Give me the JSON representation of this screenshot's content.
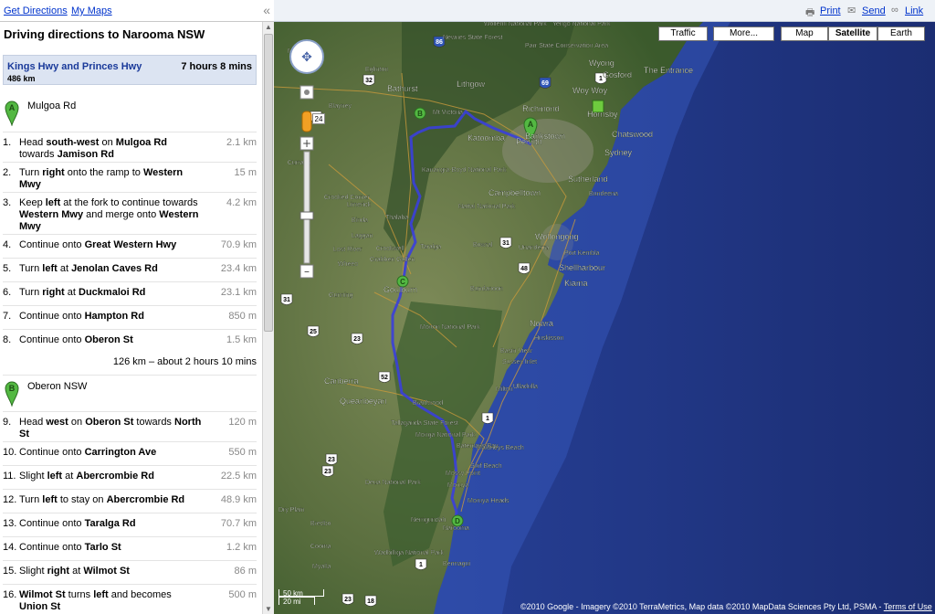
{
  "header": {
    "get_directions": "Get Directions",
    "my_maps": "My Maps",
    "collapse": "«"
  },
  "directions": {
    "title": "Driving directions to Narooma NSW",
    "route": {
      "name": "Kings Hwy and Princes Hwy",
      "time": "7 hours 8 mins",
      "distance": "486 km"
    },
    "waypoint_a": {
      "label": "A",
      "name": "Mulgoa Rd"
    },
    "waypoint_b": {
      "label": "B",
      "name": "Oberon NSW"
    },
    "summary_ab": "126 km – about 2 hours 10 mins",
    "steps": [
      {
        "n": "1.",
        "t": "Head <b>south-west</b> on <b>Mulgoa Rd</b> towards <b>Jamison Rd</b>",
        "d": "2.1 km"
      },
      {
        "n": "2.",
        "t": "Turn <b>right</b> onto the ramp to <b>Western Mwy</b>",
        "d": "15 m"
      },
      {
        "n": "3.",
        "t": "Keep <b>left</b> at the fork to continue towards <b>Western Mwy</b> and merge onto <b>Western Mwy</b>",
        "d": "4.2 km"
      },
      {
        "n": "4.",
        "t": "Continue onto <b>Great Western Hwy</b>",
        "d": "70.9 km"
      },
      {
        "n": "5.",
        "t": "Turn <b>left</b> at <b>Jenolan Caves Rd</b>",
        "d": "23.4 km"
      },
      {
        "n": "6.",
        "t": "Turn <b>right</b> at <b>Duckmaloi Rd</b>",
        "d": "23.1 km"
      },
      {
        "n": "7.",
        "t": "Continue onto <b>Hampton Rd</b>",
        "d": "850 m"
      },
      {
        "n": "8.",
        "t": "Continue onto <b>Oberon St</b>",
        "d": "1.5 km"
      }
    ],
    "steps_b": [
      {
        "n": "9.",
        "t": "Head <b>west</b> on <b>Oberon St</b> towards <b>North St</b>",
        "d": "120 m"
      },
      {
        "n": "10.",
        "t": "Continue onto <b>Carrington Ave</b>",
        "d": "550 m"
      },
      {
        "n": "11.",
        "t": "Slight <b>left</b> at <b>Abercrombie Rd</b>",
        "d": "22.5 km"
      },
      {
        "n": "12.",
        "t": "Turn <b>left</b> to stay on <b>Abercrombie Rd</b>",
        "d": "48.9 km"
      },
      {
        "n": "13.",
        "t": "Continue onto <b>Taralga Rd</b>",
        "d": "70.7 km"
      },
      {
        "n": "14.",
        "t": "Continue onto <b>Tarlo St</b>",
        "d": "1.2 km"
      },
      {
        "n": "15.",
        "t": "Slight <b>right</b> at <b>Wilmot St</b>",
        "d": "86 m"
      },
      {
        "n": "16.",
        "t": "<b>Wilmot St</b> turns <b>left</b> and becomes <b>Union St</b>",
        "d": "500 m"
      }
    ]
  },
  "map_toolbar": {
    "print": "Print",
    "send": "Send",
    "link": "Link",
    "buttons": [
      "Traffic",
      "More...",
      "Map",
      "Satellite",
      "Earth"
    ],
    "selected": "Satellite"
  },
  "map": {
    "places": [
      "Wollemi National Park",
      "Yengo National Park",
      "Mudgee",
      "Newnes State Forest",
      "Parr State Conservation Area",
      "Wyong",
      "The Entrance",
      "Gosford",
      "Eglinton",
      "Bathurst",
      "Lithgow",
      "Mt Victoria",
      "Richmond",
      "Woy Woy",
      "Hornsby",
      "Blayney",
      "Katoomba",
      "Penrith",
      "Chatswood",
      "Sydney",
      "Bankstown",
      "Sutherland",
      "Kanangra-Boyd National Park",
      "Campbelltown",
      "Curragh",
      "Crooked Corner",
      "Limerick",
      "Thalaba",
      "Binda",
      "Laggan",
      "Nattai National Park",
      "Wollongong",
      "Bundeena",
      "Taralga",
      "Bowral",
      "Unanderra",
      "Port Kembla",
      "Lost River",
      "Crookwell",
      "Wheeo",
      "Grabben Gullen",
      "Shellharbour",
      "Kiama",
      "Gunning",
      "Goulburn",
      "Bundanoon",
      "Morton National Park",
      "Nowra",
      "Huskisson",
      "Canberra",
      "Queanbeyan",
      "Braidwood",
      "Basin View",
      "Sussex Inlet",
      "Ulladulla",
      "Milton",
      "Tallaganda State Forest",
      "Monga National Park",
      "Batemans Bay",
      "Maloneys Beach",
      "Surf Beach",
      "Mossy Point",
      "Moruya",
      "Moruya Heads",
      "Deua National Park",
      "Nerrigundah",
      "Narooma",
      "Bermagui",
      "Wadbilliga National Park",
      "Dry Plain",
      "Bredbo",
      "Cooma",
      "Myalla"
    ],
    "scale_km": "50 km",
    "scale_mi": "20 mi",
    "copyright": "©2010 Google - Imagery ©2010 TerraMetrics, Map data ©2010 MapData Sciences Pty Ltd, PSMA -",
    "terms": "Terms of Use",
    "markers": [
      "A",
      "B",
      "C",
      "D"
    ],
    "shields": [
      "86",
      "32",
      "69",
      "1",
      "24",
      "31",
      "31",
      "48",
      "25",
      "23",
      "52",
      "1",
      "23",
      "23",
      "1",
      "18",
      "23"
    ]
  },
  "colors": {
    "route": "#3a3fdc",
    "marker": "#53b842",
    "land": "#5e7644",
    "ocean": "#1f3588",
    "link": "#0033cc"
  }
}
